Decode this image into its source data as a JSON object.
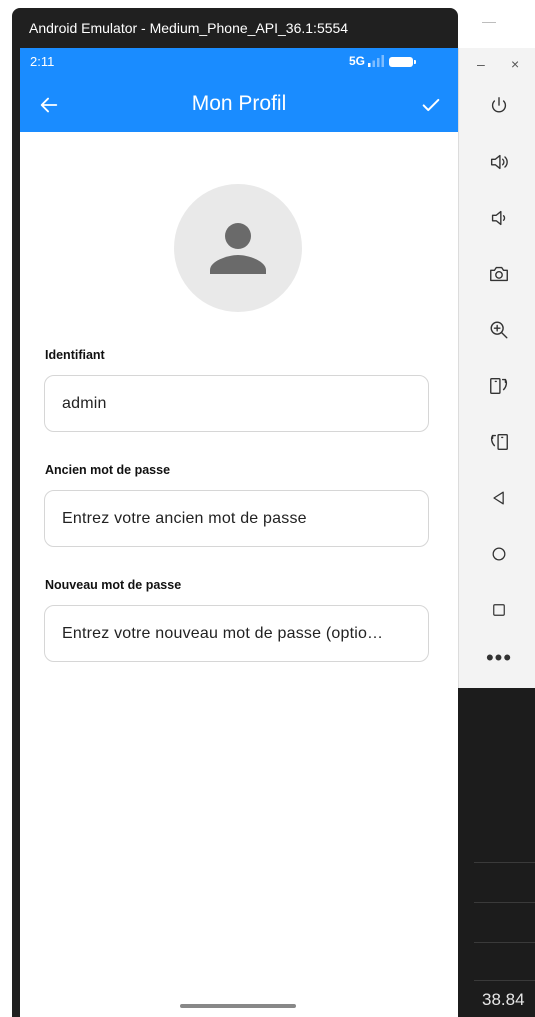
{
  "window": {
    "title": "Android Emulator - Medium_Phone_API_36.1:5554"
  },
  "status_bar": {
    "time": "2:11",
    "network": "5G"
  },
  "app_bar": {
    "title": "Mon Profil"
  },
  "form": {
    "username_label": "Identifiant",
    "username_value": "admin",
    "old_password_label": "Ancien mot de passe",
    "old_password_placeholder": "Entrez votre ancien mot de passe",
    "new_password_label": "Nouveau mot de passe",
    "new_password_placeholder": "Entrez votre nouveau mot de passe (optio…"
  },
  "emulator_toolbar": {
    "minimize_glyph": "–",
    "close_glyph": "×",
    "items": [
      "power-icon",
      "volume-up-icon",
      "volume-down-icon",
      "camera-icon",
      "zoom-icon",
      "rotate-left-icon",
      "rotate-right-icon",
      "back-icon",
      "home-icon",
      "overview-icon",
      "more-icon"
    ],
    "more_glyph": "•••"
  },
  "background_text": {
    "partial_value": "38.84"
  },
  "colors": {
    "primary": "#1a8cff",
    "window_frame": "#202020"
  }
}
